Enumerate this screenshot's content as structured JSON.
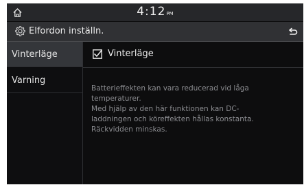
{
  "status_bar": {
    "home_icon": "home-icon",
    "time": "4:12",
    "ampm": "PM"
  },
  "title_bar": {
    "settings_icon": "gear-icon",
    "title": "Elfordon inställn.",
    "back_icon": "back-arrow-icon"
  },
  "sidebar": {
    "items": [
      {
        "label": "Vinterläge",
        "selected": true
      },
      {
        "label": "Varning",
        "selected": false
      }
    ]
  },
  "content": {
    "checkbox_label": "Vinterläge",
    "checked": true,
    "description_lines": [
      "Batterieffekten kan vara reducerad vid låga",
      "temperaturer.",
      "Med hjälp av den här funktionen kan DC-",
      "laddningen och köreffekten hållas konstanta.",
      "Räckvidden minskas."
    ]
  },
  "colors": {
    "background": "#0d0d0e",
    "title_bar": "#303134",
    "selected_item": "#34363a",
    "text": "#e6e6e6",
    "description_text": "#8c8d91"
  }
}
